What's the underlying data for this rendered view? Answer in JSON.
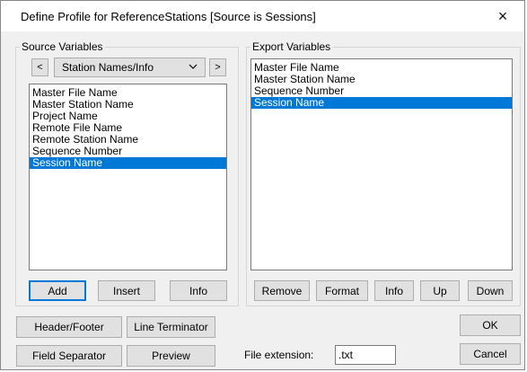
{
  "window": {
    "title": "Define Profile for ReferenceStations [Source is Sessions]",
    "close_icon": "×"
  },
  "source": {
    "group_label": "Source Variables",
    "prev_label": "<",
    "next_label": ">",
    "category": "Station Names/Info",
    "items": [
      {
        "label": "Master File Name",
        "selected": false
      },
      {
        "label": "Master Station Name",
        "selected": false
      },
      {
        "label": "Project Name",
        "selected": false
      },
      {
        "label": "Remote File Name",
        "selected": false
      },
      {
        "label": "Remote Station Name",
        "selected": false
      },
      {
        "label": "Sequence Number",
        "selected": false
      },
      {
        "label": "Session Name",
        "selected": true
      }
    ],
    "add_label": "Add",
    "insert_label": "Insert",
    "info_label": "Info"
  },
  "export": {
    "group_label": "Export Variables",
    "items": [
      {
        "label": "Master File Name",
        "selected": false
      },
      {
        "label": "Master Station Name",
        "selected": false
      },
      {
        "label": "Sequence Number",
        "selected": false
      },
      {
        "label": "Session Name",
        "selected": true
      }
    ],
    "remove_label": "Remove",
    "format_label": "Format",
    "info_label": "Info",
    "up_label": "Up",
    "down_label": "Down"
  },
  "bottom": {
    "header_footer_label": "Header/Footer",
    "line_terminator_label": "Line Terminator",
    "field_separator_label": "Field Separator",
    "preview_label": "Preview",
    "file_extension_label": "File extension:",
    "file_extension_value": ".txt",
    "ok_label": "OK",
    "cancel_label": "Cancel"
  },
  "colors": {
    "selection": "#0078d7",
    "dialog_bg": "#f0f0f0"
  }
}
